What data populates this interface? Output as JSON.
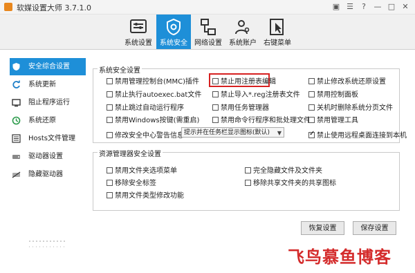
{
  "window": {
    "title": "软媒设置大师 3.7.1.0"
  },
  "toolbar": {
    "tabs": [
      {
        "label": "系统设置",
        "icon": "settings-panel-icon"
      },
      {
        "label": "系统安全",
        "icon": "shield-icon",
        "active": true
      },
      {
        "label": "网络设置",
        "icon": "network-icon"
      },
      {
        "label": "系统账户",
        "icon": "users-icon"
      },
      {
        "label": "右键菜单",
        "icon": "cursor-icon"
      }
    ]
  },
  "sidebar": {
    "items": [
      {
        "label": "安全综合设置",
        "icon": "shield-icon",
        "active": true
      },
      {
        "label": "系统更新",
        "icon": "refresh-icon"
      },
      {
        "label": "阻止程序运行",
        "icon": "block-program-icon"
      },
      {
        "label": "系统还原",
        "icon": "restore-icon"
      },
      {
        "label": "Hosts文件管理",
        "icon": "hosts-file-icon"
      },
      {
        "label": "驱动器设置",
        "icon": "drive-icon"
      },
      {
        "label": "隐藏驱动器",
        "icon": "hidden-drive-icon"
      }
    ]
  },
  "system_security": {
    "title": "系统安全设置",
    "options": [
      {
        "label": "禁用管理控制台(MMC)插件",
        "checked": false
      },
      {
        "label": "禁止用注册表编辑",
        "checked": false,
        "highlighted": true
      },
      {
        "label": "禁止修改系统还原设置",
        "checked": false
      },
      {
        "label": "禁止执行autoexec.bat文件",
        "checked": false
      },
      {
        "label": "禁止导入*.reg注册表文件",
        "checked": false
      },
      {
        "label": "禁用控制面板",
        "checked": false
      },
      {
        "label": "禁止跳过自动运行程序",
        "checked": false
      },
      {
        "label": "禁用任务管理器",
        "checked": false
      },
      {
        "label": "关机时删除系统分页文件",
        "checked": false
      },
      {
        "label": "禁用Windows按键(需重启)",
        "checked": false
      },
      {
        "label": "禁用命令行程序和批处理文件",
        "checked": false
      },
      {
        "label": "禁用管理工具",
        "checked": false
      }
    ],
    "security_center": {
      "label": "修改安全中心警告信息",
      "checked": false,
      "select_value": "提示并在任务栏显示图标(默认)"
    },
    "remote_desktop": {
      "label": "禁止使用远程桌面连接到本机",
      "checked": true
    }
  },
  "explorer_security": {
    "title": "资源管理器安全设置",
    "options": [
      {
        "label": "禁用文件夹选项菜单",
        "checked": false
      },
      {
        "label": "完全隐藏文件及文件夹",
        "checked": false
      },
      {
        "label": "移除安全标签",
        "checked": false
      },
      {
        "label": "移除共享文件夹的共享图标",
        "checked": false
      },
      {
        "label": "禁用文件类型修改功能",
        "checked": false
      }
    ]
  },
  "buttons": {
    "restore": "恢复设置",
    "save": "保存设置"
  },
  "watermark": "飞鸟慕鱼博客",
  "colors": {
    "accent": "#1e8fd8",
    "highlight": "#d62020",
    "watermark": "#d42b2b"
  }
}
